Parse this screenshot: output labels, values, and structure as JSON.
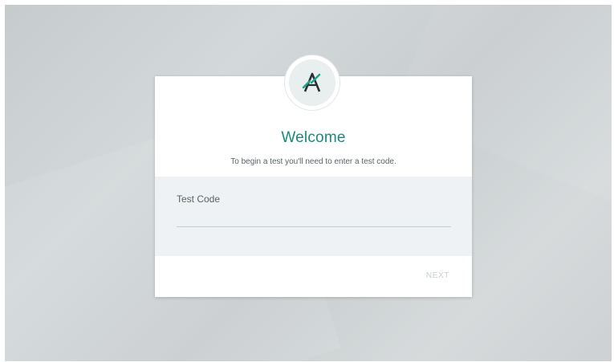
{
  "welcome": {
    "title": "Welcome",
    "subtitle": "To begin a test you'll need to enter a test code."
  },
  "form": {
    "test_code_label": "Test Code",
    "test_code_value": "",
    "test_code_placeholder": ""
  },
  "actions": {
    "next_label": "NEXT"
  },
  "logo": {
    "icon": "a-logo-icon",
    "accent_color": "#1aa38c"
  },
  "colors": {
    "title": "#168c7c",
    "background": "#c9cfd1",
    "card": "#ffffff",
    "form_area": "#eef2f4",
    "next_disabled": "#c9ced1"
  }
}
